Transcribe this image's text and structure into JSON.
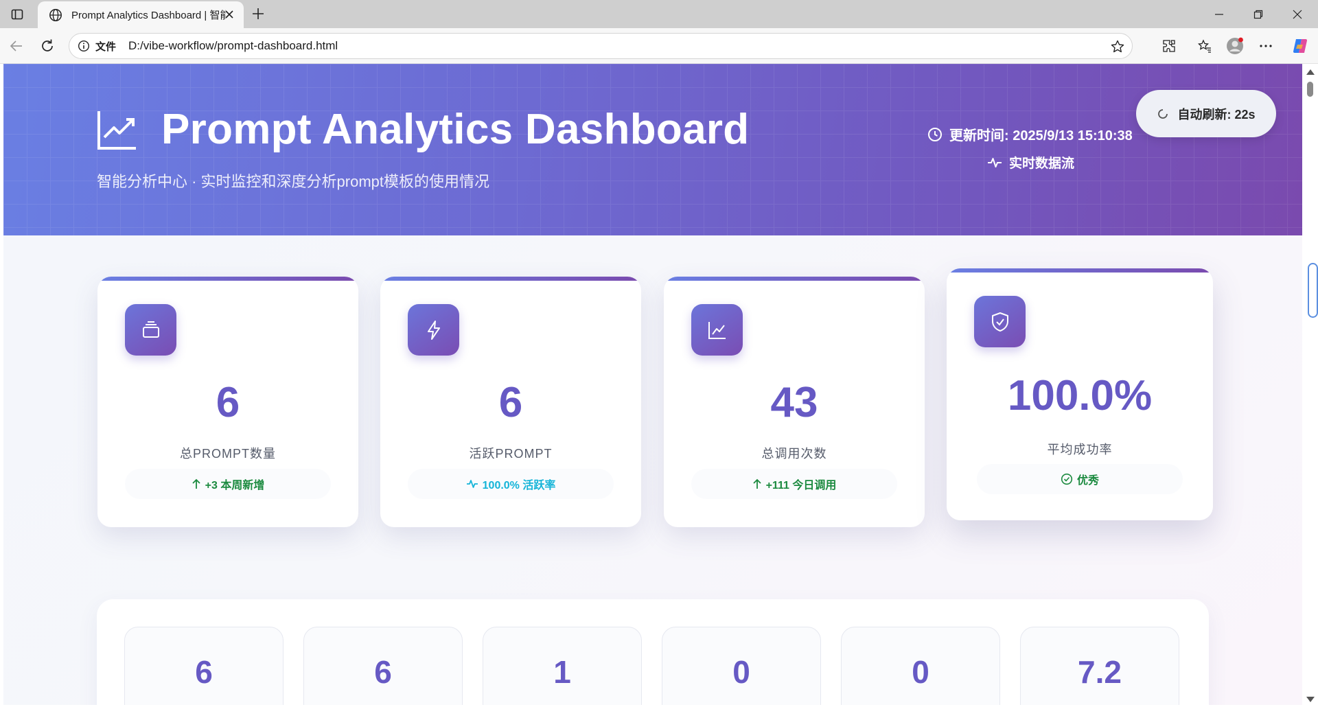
{
  "browser": {
    "tab_title": "Prompt Analytics Dashboard | 智能",
    "address_file_label": "文件",
    "url": "D:/vibe-workflow/prompt-dashboard.html"
  },
  "header": {
    "title": "Prompt Analytics Dashboard",
    "subtitle": "智能分析中心 · 实时监控和深度分析prompt模板的使用情况",
    "update_time": "更新时间: 2025/9/13 15:10:38",
    "stream_label": "实时数据流",
    "auto_refresh": "自动刷新: 22s"
  },
  "cards": [
    {
      "icon": "layers-icon",
      "value": "6",
      "label": "总PROMPT数量",
      "trend": "+3 本周新增",
      "trend_icon": "arrow-up-icon",
      "trend_color": "#1b8a3f"
    },
    {
      "icon": "bolt-icon",
      "value": "6",
      "label": "活跃PROMPT",
      "trend": "100.0% 活跃率",
      "trend_icon": "pulse-icon",
      "trend_color": "#14b4d8"
    },
    {
      "icon": "chart-line-icon",
      "value": "43",
      "label": "总调用次数",
      "trend": "+111 今日调用",
      "trend_icon": "arrow-up-icon",
      "trend_color": "#1b8a3f"
    },
    {
      "icon": "shield-check-icon",
      "value": "100.0%",
      "label": "平均成功率",
      "trend": "优秀",
      "trend_icon": "check-circle-icon",
      "trend_color": "#1b8a3f"
    }
  ],
  "mini_stats": [
    {
      "value": "6"
    },
    {
      "value": "6"
    },
    {
      "value": "1"
    },
    {
      "value": "0"
    },
    {
      "value": "0"
    },
    {
      "value": "7.2"
    }
  ],
  "colors": {
    "accent": "#6659c4",
    "header_gradient_start": "#6a7fe3",
    "header_gradient_end": "#7a4aae"
  }
}
